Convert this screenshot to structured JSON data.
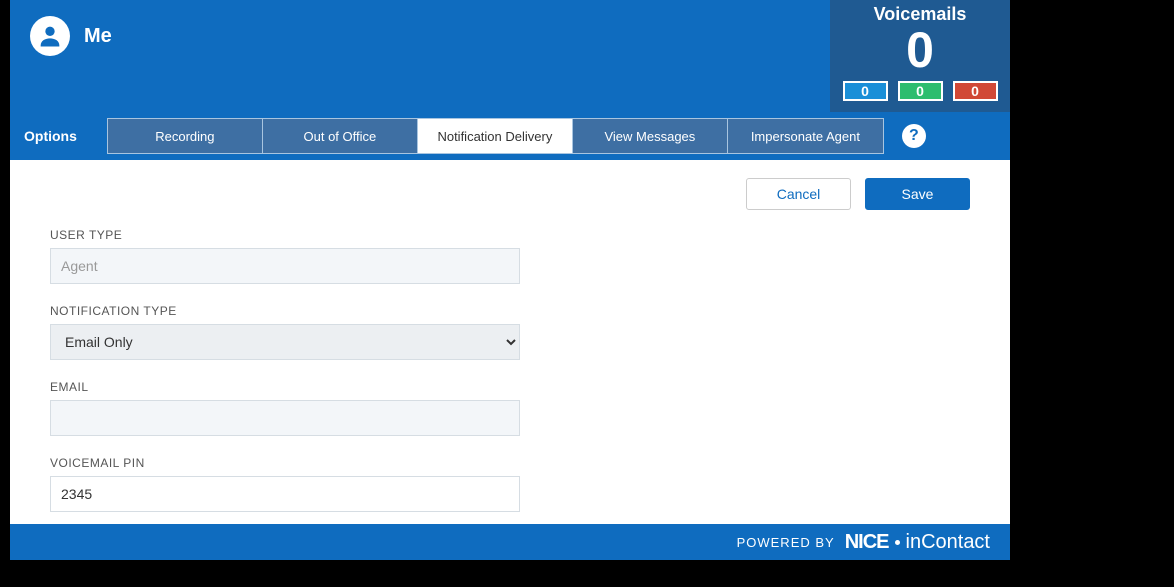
{
  "header": {
    "me_label": "Me"
  },
  "voicemails": {
    "title": "Voicemails",
    "total": "0",
    "blue": "0",
    "green": "0",
    "red": "0"
  },
  "tabbar": {
    "options_label": "Options",
    "tabs": {
      "recording": "Recording",
      "out_of_office": "Out of Office",
      "notification_delivery": "Notification Delivery",
      "view_messages": "View Messages",
      "impersonate_agent": "Impersonate Agent"
    }
  },
  "actions": {
    "cancel": "Cancel",
    "save": "Save"
  },
  "form": {
    "user_type_label": "USER TYPE",
    "user_type_value": "Agent",
    "notification_type_label": "NOTIFICATION TYPE",
    "notification_type_value": "Email Only",
    "email_label": "EMAIL",
    "email_value": "",
    "voicemail_pin_label": "VOICEMAIL PIN",
    "voicemail_pin_value": "2345"
  },
  "footer": {
    "powered_by": "POWERED BY",
    "brand_nice": "NICE",
    "brand_incontact": "inContact"
  },
  "help_glyph": "?"
}
